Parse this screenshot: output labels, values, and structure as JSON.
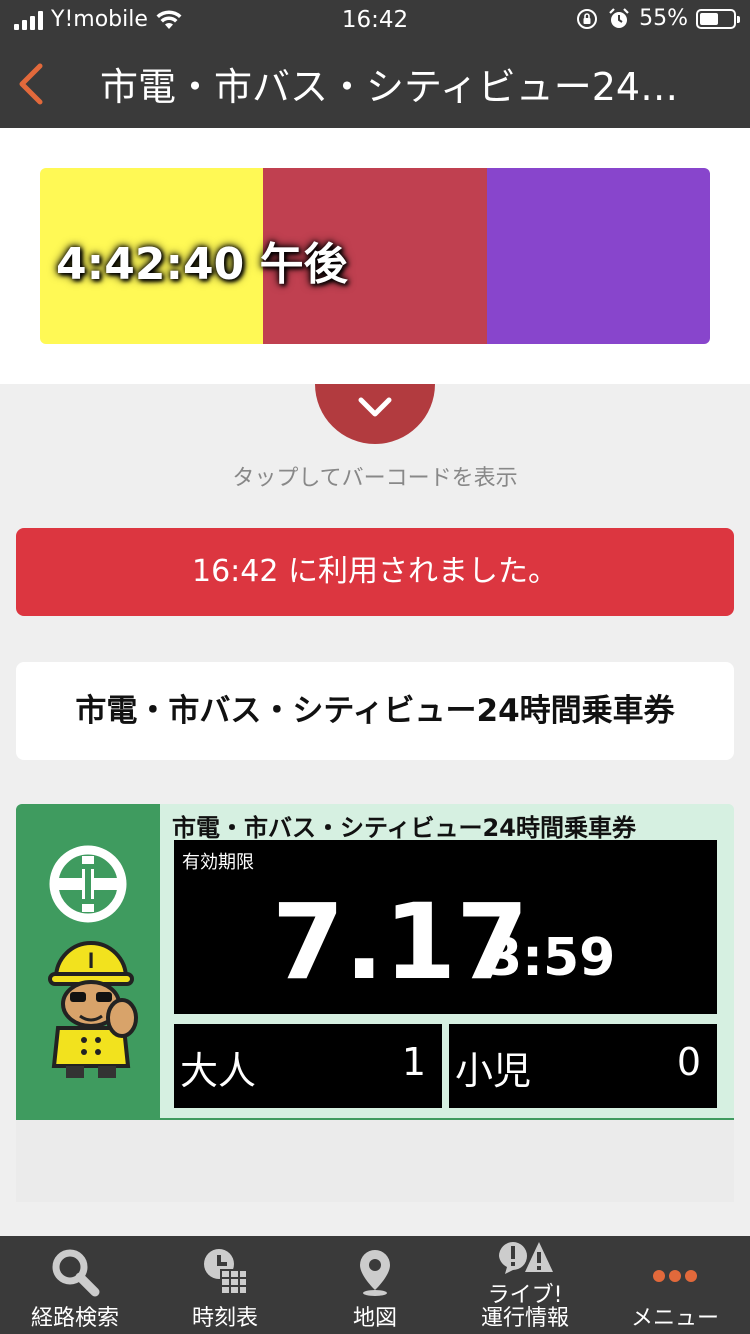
{
  "status_bar": {
    "carrier": "Y!mobile",
    "time": "16:42",
    "battery_percent_text": "55%",
    "battery_level": 0.55
  },
  "nav": {
    "title": "市電・市バス・シティビュー24…",
    "back_icon": "chevron-left-icon"
  },
  "color_panel": {
    "colors": [
      "#fff955",
      "#c04050",
      "#8845cc"
    ],
    "clock": "4:42:40 午後"
  },
  "barcode": {
    "toggle_icon": "chevron-down-icon",
    "hint": "タップしてバーコードを表示"
  },
  "usage": {
    "message": "16:42 に利用されました。"
  },
  "ticket": {
    "name": "市電・市バス・シティビュー24時間乗車券",
    "card_title": "市電・市バス・シティビュー24時間乗車券",
    "expiry_label": "有効期限",
    "expiry_date": "7.17",
    "expiry_time": "3:59",
    "adult_label": "大人",
    "adult_count": "1",
    "child_label": "小児",
    "child_count": "0",
    "accent_color": "#3f9b5f"
  },
  "tabbar": {
    "tabs": [
      {
        "label": "経路検索",
        "icon": "search-icon"
      },
      {
        "label": "時刻表",
        "icon": "timetable-icon"
      },
      {
        "label": "地図",
        "icon": "map-pin-icon"
      },
      {
        "label": "ライブ!\n運行情報",
        "icon": "alert-icon"
      },
      {
        "label": "メニュー",
        "icon": "more-icon"
      }
    ]
  }
}
